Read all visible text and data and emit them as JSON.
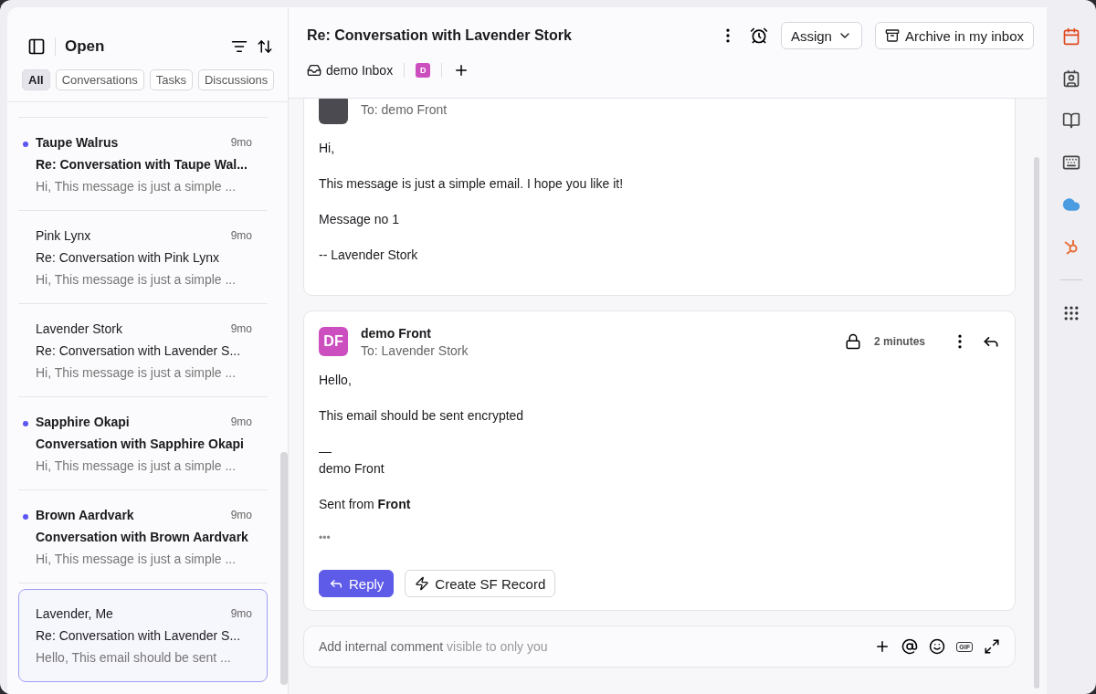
{
  "sidebar": {
    "title": "Open",
    "filters": [
      {
        "label": "All",
        "selected": true
      },
      {
        "label": "Conversations",
        "selected": false
      },
      {
        "label": "Tasks",
        "selected": false
      },
      {
        "label": "Discussions",
        "selected": false
      }
    ],
    "conversations": [
      {
        "name": "Taupe Walrus",
        "time": "9mo",
        "subject": "Re: Conversation with Taupe Wal...",
        "preview": "Hi, This message is just a simple ...",
        "unread": true,
        "selected": false
      },
      {
        "name": "Pink Lynx",
        "time": "9mo",
        "subject": "Re: Conversation with Pink Lynx",
        "preview": "Hi, This message is just a simple ...",
        "unread": false,
        "selected": false
      },
      {
        "name": "Lavender Stork",
        "time": "9mo",
        "subject": "Re: Conversation with Lavender S...",
        "preview": "Hi, This message is just a simple ...",
        "unread": false,
        "selected": false
      },
      {
        "name": "Sapphire Okapi",
        "time": "9mo",
        "subject": "Conversation with Sapphire Okapi",
        "preview": "Hi, This message is just a simple ...",
        "unread": true,
        "selected": false
      },
      {
        "name": "Brown Aardvark",
        "time": "9mo",
        "subject": "Conversation with Brown Aardvark",
        "preview": "Hi, This message is just a simple ...",
        "unread": true,
        "selected": false
      },
      {
        "name": "Lavender, Me",
        "time": "9mo",
        "subject": "Re: Conversation with Lavender S...",
        "preview": "Hello, This email should be sent ...",
        "unread": false,
        "selected": true
      }
    ]
  },
  "header": {
    "title": "Re: Conversation with Lavender Stork",
    "assign": "Assign",
    "archive": "Archive in my inbox",
    "inbox": "demo Inbox",
    "teammate_initial": "D"
  },
  "messages": [
    {
      "recipient": "To: demo Front",
      "body": [
        "Hi,",
        "This message is just a simple email. I hope you like it!",
        "Message no 1",
        "-- Lavender Stork"
      ]
    },
    {
      "initials": "DF",
      "sender": "demo Front",
      "recipient": "To: Lavender Stork",
      "time": "2 minutes",
      "body": [
        "Hello,",
        "This email should be sent encrypted",
        "—\ndemo Front",
        "Sent from **Front**"
      ],
      "more": "•••",
      "reply": "Reply",
      "action": "Create SF Record"
    }
  ],
  "comment": {
    "placeholder": "Add internal comment",
    "hint": "visible to only you",
    "gif": "GIF"
  }
}
